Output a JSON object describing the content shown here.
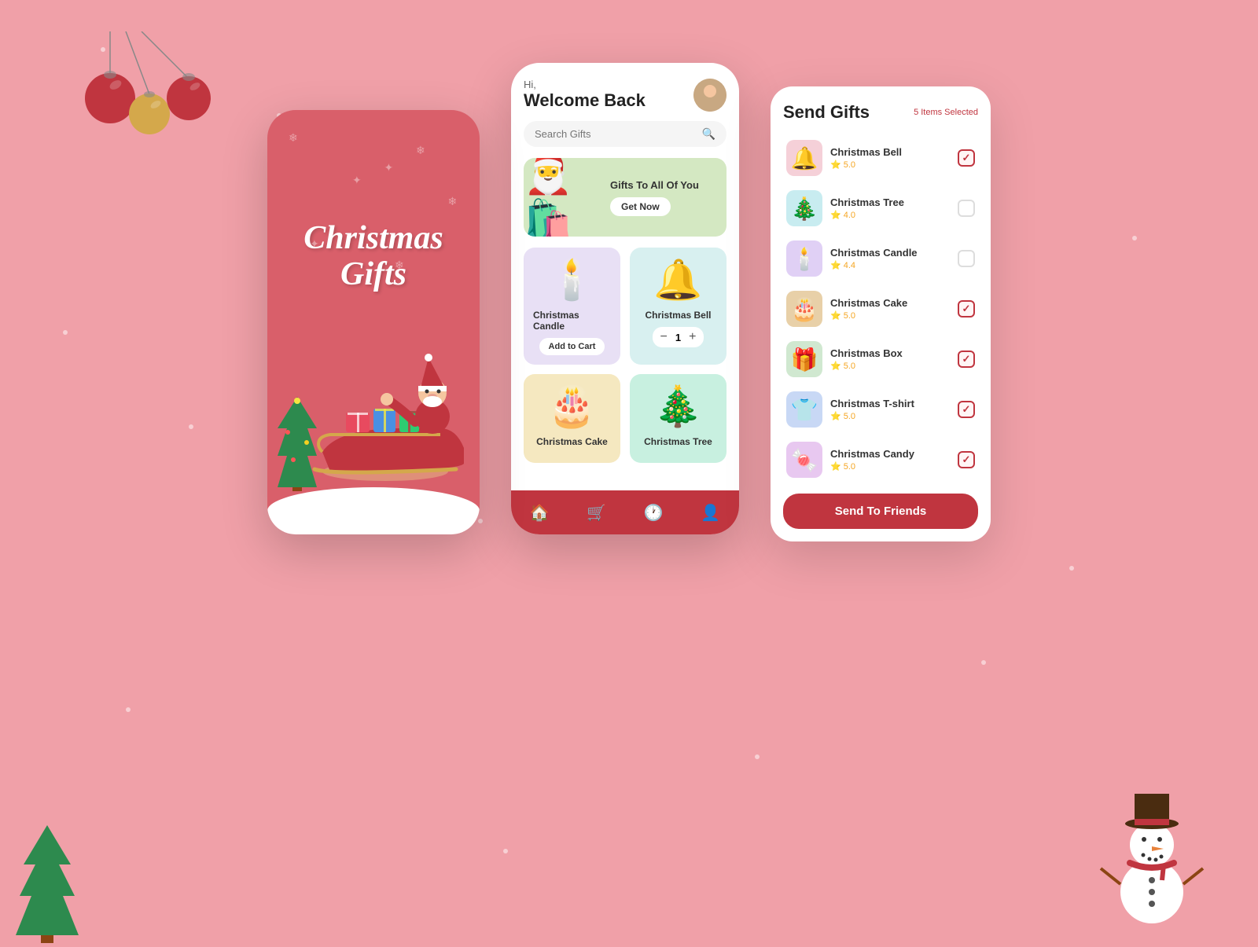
{
  "background": {
    "color": "#f0a0a8"
  },
  "left_phone": {
    "title_line1": "Christmas",
    "title_line2": "Gifts"
  },
  "mid_phone": {
    "greeting": "Hi,",
    "welcome": "Welcome Back",
    "search_placeholder": "Search Gifts",
    "banner": {
      "title": "Gifts To All Of You",
      "button": "Get Now"
    },
    "products": [
      {
        "name": "Christmas Candle",
        "emoji": "🕯️",
        "color": "purple",
        "action": "add_to_cart",
        "action_label": "Add to Cart"
      },
      {
        "name": "Christmas Bell",
        "emoji": "🔔",
        "color": "teal",
        "action": "qty",
        "qty": 1
      },
      {
        "name": "Christmas Cake",
        "emoji": "🎂",
        "color": "yellow",
        "action": "none"
      },
      {
        "name": "Christmas Tree",
        "emoji": "🎄",
        "color": "mint",
        "action": "none"
      }
    ],
    "nav": [
      {
        "icon": "🏠",
        "name": "home"
      },
      {
        "icon": "🛒",
        "name": "cart"
      },
      {
        "icon": "🕐",
        "name": "history"
      },
      {
        "icon": "👤",
        "name": "profile"
      }
    ]
  },
  "right_panel": {
    "title": "Send Gifts",
    "items_selected": "5 Items Selected",
    "send_button": "Send To Friends",
    "gifts": [
      {
        "name": "Christmas Bell",
        "rating": "5.0",
        "emoji": "🔔",
        "bg": "pink-bg",
        "checked": true
      },
      {
        "name": "Christmas Tree",
        "rating": "4.0",
        "emoji": "🎄",
        "bg": "teal-bg",
        "checked": false
      },
      {
        "name": "Christmas Candle",
        "rating": "4.4",
        "emoji": "🕯️",
        "bg": "lavender-bg",
        "checked": false
      },
      {
        "name": "Christmas Cake",
        "rating": "5.0",
        "emoji": "🎂",
        "bg": "tan-bg",
        "checked": true
      },
      {
        "name": "Christmas Box",
        "rating": "5.0",
        "emoji": "🎁",
        "bg": "green-bg",
        "checked": true
      },
      {
        "name": "Christmas T-shirt",
        "rating": "5.0",
        "emoji": "👕",
        "bg": "blue-bg",
        "checked": true
      },
      {
        "name": "Christmas Candy",
        "rating": "5.0",
        "emoji": "🍬",
        "bg": "purple-bg",
        "checked": true
      }
    ]
  }
}
